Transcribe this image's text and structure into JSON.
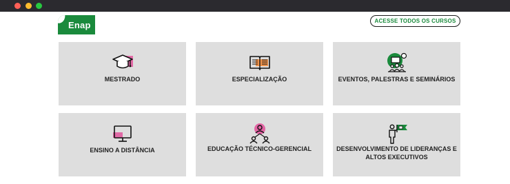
{
  "header": {
    "logo_text": "Enap",
    "all_courses_label": "ACESSE TODOS OS CURSOS"
  },
  "colors": {
    "brand_green": "#1a8a3c",
    "accent_pink": "#e2569c",
    "accent_orange": "#f28c3c",
    "card_bg": "#dedede"
  },
  "cards": [
    {
      "label": "MESTRADO",
      "icon": "graduation-cap-icon"
    },
    {
      "label": "ESPECIALIZAÇÃO",
      "icon": "open-book-icon"
    },
    {
      "label": "EVENTOS, PALESTRAS E SEMINÁRIOS",
      "icon": "audience-presentation-icon"
    },
    {
      "label": "ENSINO A DISTÂNCIA",
      "icon": "computer-monitor-icon"
    },
    {
      "label": "EDUCAÇÃO TÉCNICO-GERENCIAL",
      "icon": "team-network-icon"
    },
    {
      "label": "DESENVOLVIMENTO DE LIDERANÇAS E ALTOS EXECUTIVOS",
      "icon": "leader-flag-icon"
    }
  ]
}
